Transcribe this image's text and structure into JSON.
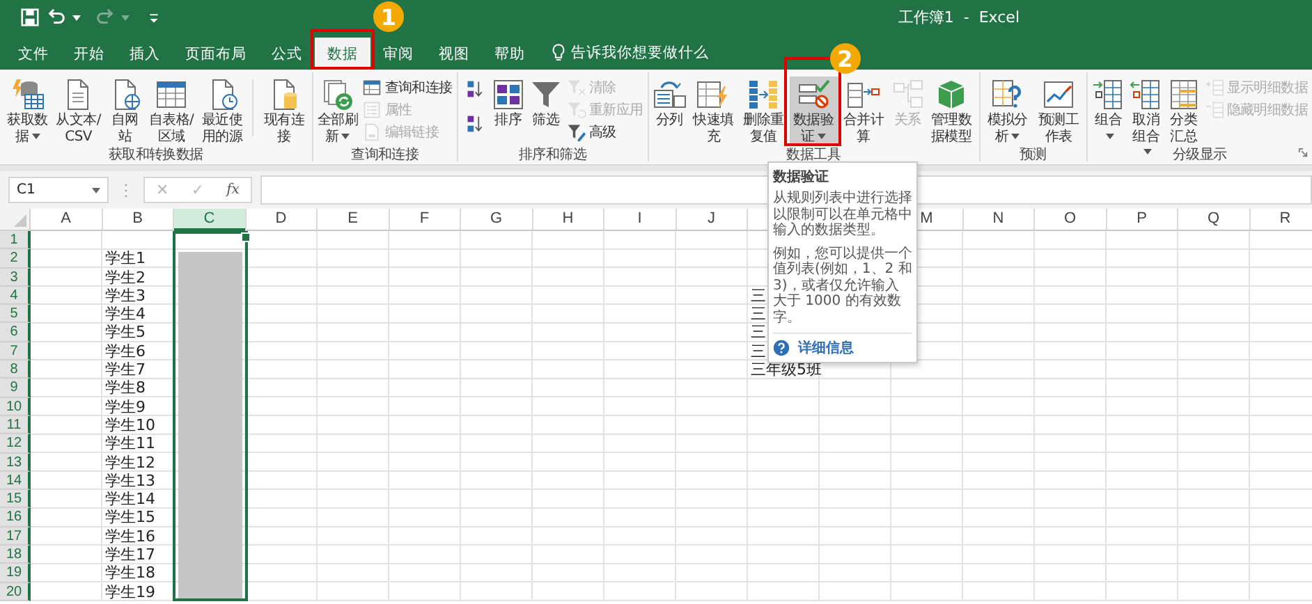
{
  "window": {
    "title": "工作簿1  -  Excel"
  },
  "quick_access": [
    {
      "disabled": false,
      "dropdown": false
    },
    {
      "disabled": false,
      "dropdown": true
    },
    {
      "disabled": true,
      "dropdown": true
    },
    {
      "disabled": false,
      "dropdown": false
    }
  ],
  "tabs": [
    {
      "label": "文件",
      "selected": false
    },
    {
      "label": "开始",
      "selected": false
    },
    {
      "label": "插入",
      "selected": false
    },
    {
      "label": "页面布局",
      "selected": false
    },
    {
      "label": "公式",
      "selected": false
    },
    {
      "label": "数据",
      "selected": true
    },
    {
      "label": "审阅",
      "selected": false
    },
    {
      "label": "视图",
      "selected": false
    },
    {
      "label": "帮助",
      "selected": false
    }
  ],
  "tell_me": {
    "text": "告诉我你想要做什么"
  },
  "annotations": [
    {
      "label": "1"
    },
    {
      "label": "2"
    }
  ],
  "ribbon": {
    "groups": [
      {
        "label": "获取和转换数据",
        "buttons": [
          {
            "kind": "large",
            "label": "获取数据",
            "dropdown": true,
            "disabled": false,
            "highlighted": false
          },
          {
            "kind": "large",
            "label": "从文本/CSV",
            "dropdown": false,
            "disabled": false,
            "highlighted": false
          },
          {
            "kind": "large",
            "label": "自网站",
            "dropdown": false,
            "disabled": false,
            "highlighted": false
          },
          {
            "kind": "large",
            "label": "自表格/区域",
            "dropdown": false,
            "disabled": false,
            "highlighted": false
          },
          {
            "kind": "large",
            "label": "最近使用的源",
            "dropdown": false,
            "disabled": false,
            "highlighted": false
          },
          {
            "kind": "separator"
          },
          {
            "kind": "large",
            "label": "现有连接",
            "dropdown": false,
            "disabled": false,
            "highlighted": false
          }
        ]
      },
      {
        "label": "查询和连接",
        "buttons": [
          {
            "kind": "large",
            "label": "全部刷新",
            "dropdown": true,
            "disabled": false,
            "highlighted": false
          },
          {
            "kind": "stack",
            "items": [
              {
                "label": "查询和连接",
                "disabled": false
              },
              {
                "label": "属性",
                "disabled": true
              },
              {
                "label": "编辑链接",
                "disabled": true
              }
            ]
          }
        ]
      },
      {
        "label": "排序和筛选",
        "buttons": [
          {
            "kind": "stack",
            "items": [
              {
                "disabled": false
              },
              {
                "disabled": false
              }
            ]
          },
          {
            "kind": "large",
            "label": "排序",
            "dropdown": false,
            "disabled": false,
            "highlighted": false
          },
          {
            "kind": "large",
            "label": "筛选",
            "dropdown": false,
            "disabled": false,
            "highlighted": false
          },
          {
            "kind": "stack",
            "items": [
              {
                "label": "清除",
                "disabled": true
              },
              {
                "label": "重新应用",
                "disabled": true
              },
              {
                "label": "高级",
                "disabled": false
              }
            ]
          }
        ]
      },
      {
        "label": "数据工具",
        "buttons": [
          {
            "kind": "large",
            "label": "分列",
            "dropdown": false,
            "disabled": false,
            "highlighted": false
          },
          {
            "kind": "large",
            "label": "快速填充",
            "dropdown": false,
            "disabled": false,
            "highlighted": false
          },
          {
            "kind": "large",
            "label": "删除重复值",
            "dropdown": false,
            "disabled": false,
            "highlighted": false
          },
          {
            "kind": "large",
            "label": "数据验证",
            "dropdown": true,
            "disabled": false,
            "highlighted": true
          },
          {
            "kind": "large",
            "label": "合并计算",
            "dropdown": false,
            "disabled": false,
            "highlighted": false
          },
          {
            "kind": "large",
            "label": "关系",
            "dropdown": false,
            "disabled": true,
            "highlighted": false
          },
          {
            "kind": "large",
            "label": "管理数据模型",
            "dropdown": false,
            "disabled": false,
            "highlighted": false
          }
        ]
      },
      {
        "label": "预测",
        "buttons": [
          {
            "kind": "large",
            "label": "模拟分析",
            "dropdown": true,
            "disabled": false,
            "highlighted": false
          },
          {
            "kind": "large",
            "label": "预测工作表",
            "dropdown": false,
            "disabled": false,
            "highlighted": false
          }
        ]
      },
      {
        "label": "分级显示",
        "buttons": [
          {
            "kind": "large",
            "label": "组合",
            "dropdown": true,
            "disabled": false,
            "highlighted": false
          },
          {
            "kind": "large",
            "label": "取消组合",
            "dropdown": true,
            "disabled": false,
            "highlighted": false
          },
          {
            "kind": "large",
            "label": "分类汇总",
            "dropdown": false,
            "disabled": false,
            "highlighted": false
          },
          {
            "kind": "stack",
            "items": [
              {
                "label": "显示明细数据",
                "disabled": true
              },
              {
                "label": "隐藏明细数据",
                "disabled": true
              }
            ]
          }
        ]
      }
    ]
  },
  "formula_bar": {
    "name_box": "C1",
    "cancel": {
      "glyph": "✕",
      "disabled": true
    },
    "enter": {
      "glyph": "✓",
      "disabled": true
    },
    "function": "fx"
  },
  "sheet": {
    "columns_left": [
      {
        "label": "A",
        "selected": false
      },
      {
        "label": "B",
        "selected": false
      },
      {
        "label": "C",
        "selected": true
      },
      {
        "label": "D",
        "selected": false
      },
      {
        "label": "E",
        "selected": false
      },
      {
        "label": "F",
        "selected": false
      },
      {
        "label": "G",
        "selected": false
      },
      {
        "label": "H",
        "selected": false
      },
      {
        "label": "I",
        "selected": false
      },
      {
        "label": "J",
        "selected": false
      }
    ],
    "columns_right": [
      {
        "label": "M",
        "selected": false
      },
      {
        "label": "N",
        "selected": false
      },
      {
        "label": "O",
        "selected": false
      },
      {
        "label": "P",
        "selected": false
      },
      {
        "label": "Q",
        "selected": false
      },
      {
        "label": "R",
        "selected": false
      }
    ],
    "rows": [
      {
        "number": "1"
      },
      {
        "number": "2",
        "column_b": "学生1"
      },
      {
        "number": "3",
        "column_b": "学生2"
      },
      {
        "number": "4",
        "column_b": "学生3",
        "column_k": "三"
      },
      {
        "number": "5",
        "column_b": "学生4",
        "column_k": "三"
      },
      {
        "number": "6",
        "column_b": "学生5",
        "column_k": "三"
      },
      {
        "number": "7",
        "column_b": "学生6",
        "column_k": "三"
      },
      {
        "number": "8",
        "column_b": "学生7",
        "column_k": "三年级5班"
      },
      {
        "number": "9",
        "column_b": "学生8"
      },
      {
        "number": "10",
        "column_b": "学生9"
      },
      {
        "number": "11",
        "column_b": "学生10"
      },
      {
        "number": "12",
        "column_b": "学生11"
      },
      {
        "number": "13",
        "column_b": "学生12"
      },
      {
        "number": "14",
        "column_b": "学生13"
      },
      {
        "number": "15",
        "column_b": "学生14"
      },
      {
        "number": "16",
        "column_b": "学生15"
      },
      {
        "number": "17",
        "column_b": "学生16"
      },
      {
        "number": "18",
        "column_b": "学生17"
      },
      {
        "number": "19",
        "column_b": "学生18"
      },
      {
        "number": "20",
        "column_b": "学生19"
      }
    ]
  },
  "tooltip": {
    "title": "数据验证",
    "paragraphs": [
      "从规则列表中进行选择以限制可以在单元格中输入的数据类型。",
      "例如，您可以提供一个值列表(例如，1、2 和 3)，或者仅允许输入大于 1000 的有效数字。"
    ],
    "link": "详细信息"
  }
}
